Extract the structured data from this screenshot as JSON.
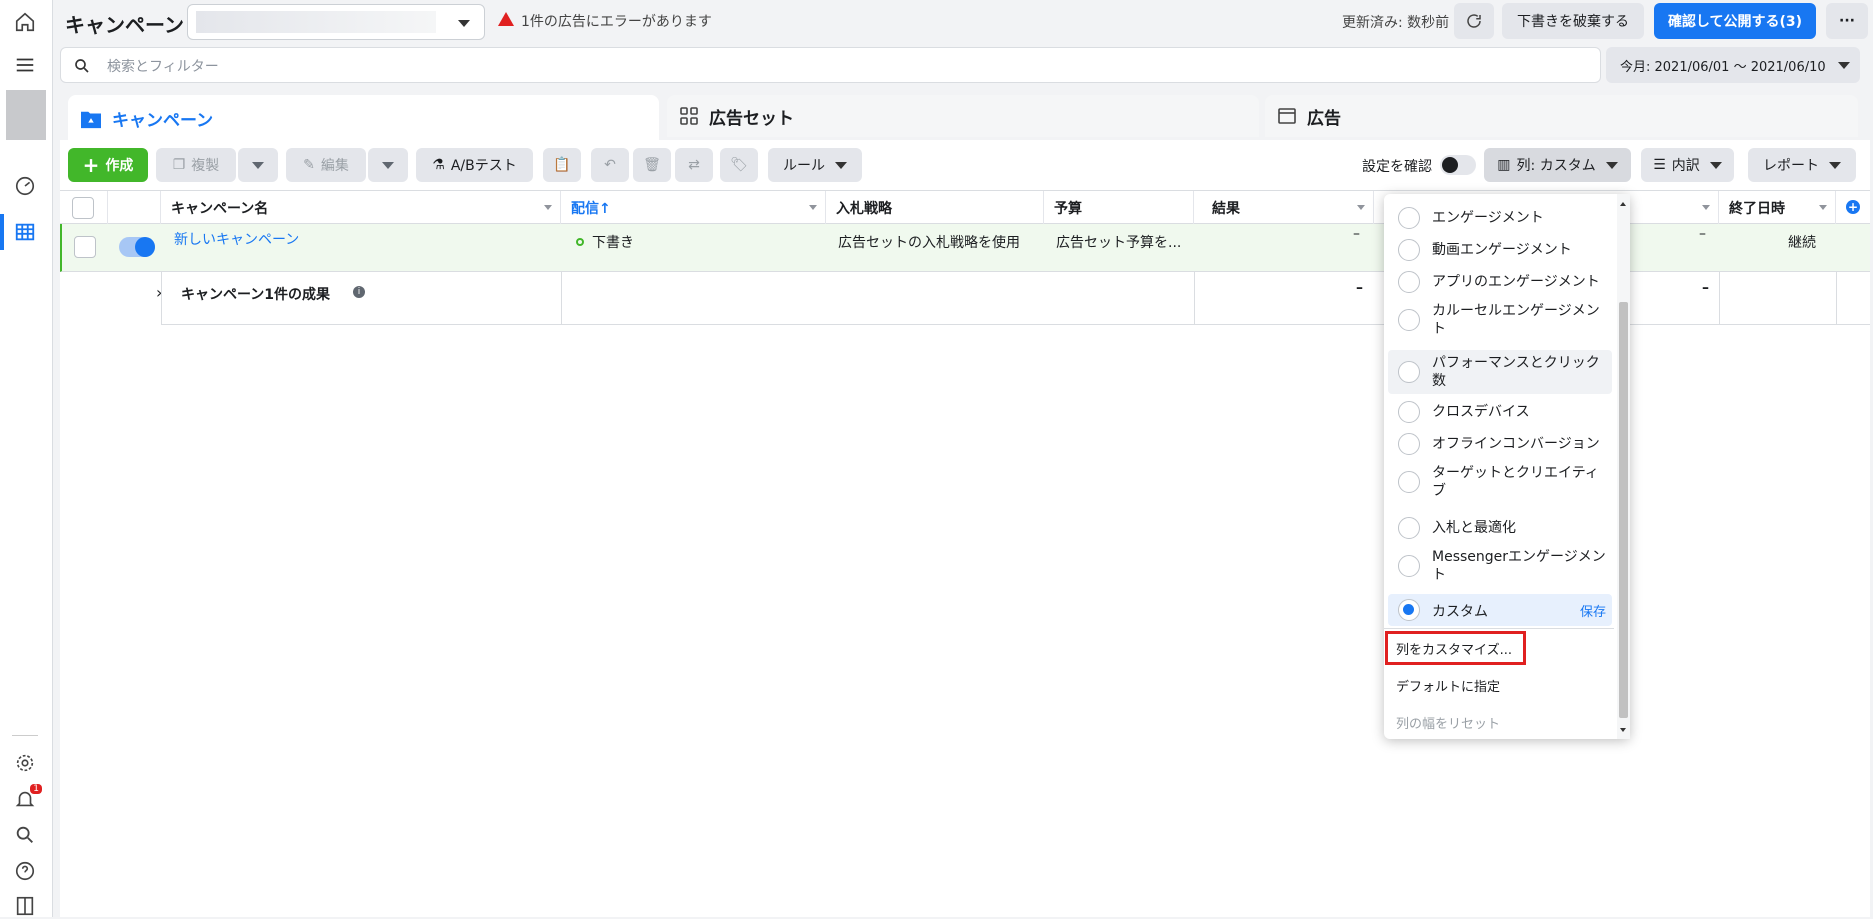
{
  "nav": {
    "icons": [
      "home-icon",
      "menu-icon",
      "account-avatar",
      "dashboard-icon",
      "table-icon",
      "settings-icon",
      "notification-icon",
      "search-icon",
      "help-icon",
      "panel-icon"
    ],
    "notification_count": "1"
  },
  "header": {
    "title": "キャンペーン",
    "error_text": "1件の広告にエラーがあります",
    "updated": "更新済み: 数秒前",
    "discard": "下書きを破棄する",
    "publish": "確認して公開する(3)",
    "more": "···"
  },
  "search": {
    "placeholder": "検索とフィルター",
    "date_range": "今月: 2021/06/01 ～ 2021/06/10"
  },
  "tabs": {
    "campaign": "キャンペーン",
    "adset": "広告セット",
    "ad": "広告"
  },
  "toolbar": {
    "create": "作成",
    "duplicate": "複製",
    "edit": "編集",
    "abtest": "A/Bテスト",
    "rules": "ルール",
    "confirm_settings": "設定を確認",
    "columns": "列: カスタム",
    "breakdown": "内訳",
    "reports": "レポート"
  },
  "table": {
    "headers": {
      "name": "キャンペーン名",
      "delivery": "配信↑",
      "bid": "入札戦略",
      "budget": "予算",
      "results": "結果",
      "end": "終了日時"
    },
    "row": {
      "name": "新しいキャンペーン",
      "delivery": "下書き",
      "bid": "広告セットの入札戦略を使用",
      "budget": "広告セット予算を...",
      "results": "–",
      "dash2": "–",
      "end": "継続"
    },
    "summary": {
      "label": "キャンペーン1件の成果",
      "results": "–",
      "dash2": "–"
    }
  },
  "dropdown": {
    "options": [
      "エンゲージメント",
      "動画エンゲージメント",
      "アプリのエンゲージメント",
      "カルーセルエンゲージメント",
      "パフォーマンスとクリック数",
      "クロスデバイス",
      "オフラインコンバージョン",
      "ターゲットとクリエイティブ",
      "入札と最適化",
      "Messengerエンゲージメント"
    ],
    "selected": "カスタム",
    "save": "保存",
    "customize": "列をカスタマイズ...",
    "set_default": "デフォルトに指定",
    "reset_width": "列の幅をリセット"
  },
  "colors": {
    "accent": "#1877f2",
    "create_green": "#42b72a",
    "error_red": "#e02020",
    "highlight_box": "#e02020"
  }
}
